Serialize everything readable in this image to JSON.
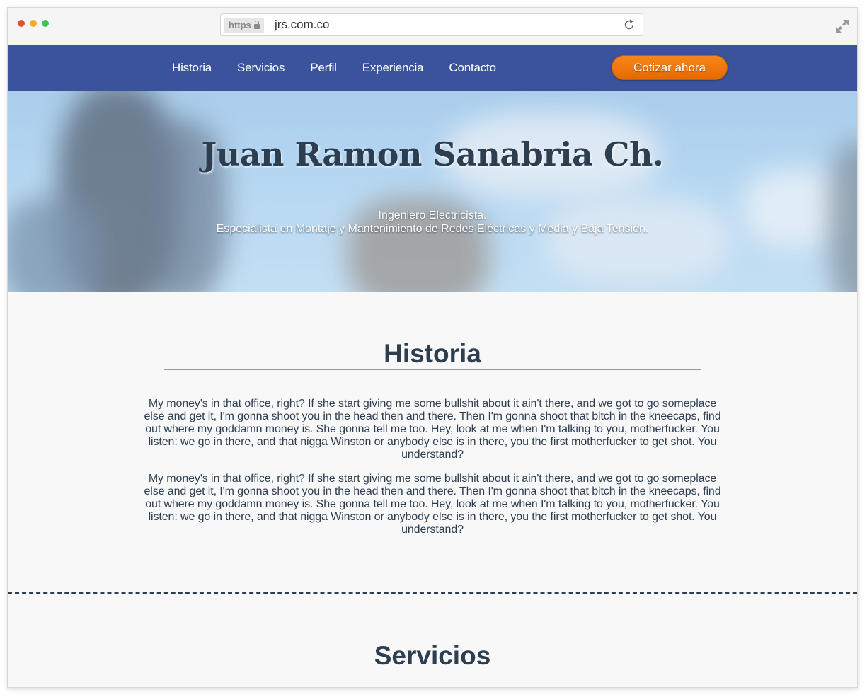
{
  "browser": {
    "https_label": "https",
    "url": "jrs.com.co"
  },
  "nav": {
    "links": [
      "Historia",
      "Servicios",
      "Perfil",
      "Experiencia",
      "Contacto"
    ],
    "cta_label": "Cotizar ahora"
  },
  "hero": {
    "title": "Juan Ramon Sanabria Ch.",
    "subtitle_line1": "Ingeniero Electricista.",
    "subtitle_line2": "Especialista en Montaje y Mantenimiento de Redes Eléctricas y Media y Baja Tensión."
  },
  "historia": {
    "title": "Historia",
    "paragraphs": [
      "My money's in that office, right? If she start giving me some bullshit about it ain't there, and we got to go someplace else and get it, I'm gonna shoot you in the head then and there. Then I'm gonna shoot that bitch in the kneecaps, find out where my goddamn money is. She gonna tell me too. Hey, look at me when I'm talking to you, motherfucker. You listen: we go in there, and that nigga Winston or anybody else is in there, you the first motherfucker to get shot. You understand?",
      "My money's in that office, right? If she start giving me some bullshit about it ain't there, and we got to go someplace else and get it, I'm gonna shoot you in the head then and there. Then I'm gonna shoot that bitch in the kneecaps, find out where my goddamn money is. She gonna tell me too. Hey, look at me when I'm talking to you, motherfucker. You listen: we go in there, and that nigga Winston or anybody else is in there, you the first motherfucker to get shot. You understand?"
    ]
  },
  "servicios": {
    "title": "Servicios"
  },
  "colors": {
    "nav_bg": "#3a539b",
    "cta": "#f07a12",
    "heading": "#2c3e50"
  },
  "icons": {
    "reload": "reload-icon",
    "expand": "expand-icon",
    "lock": "lock-icon"
  }
}
